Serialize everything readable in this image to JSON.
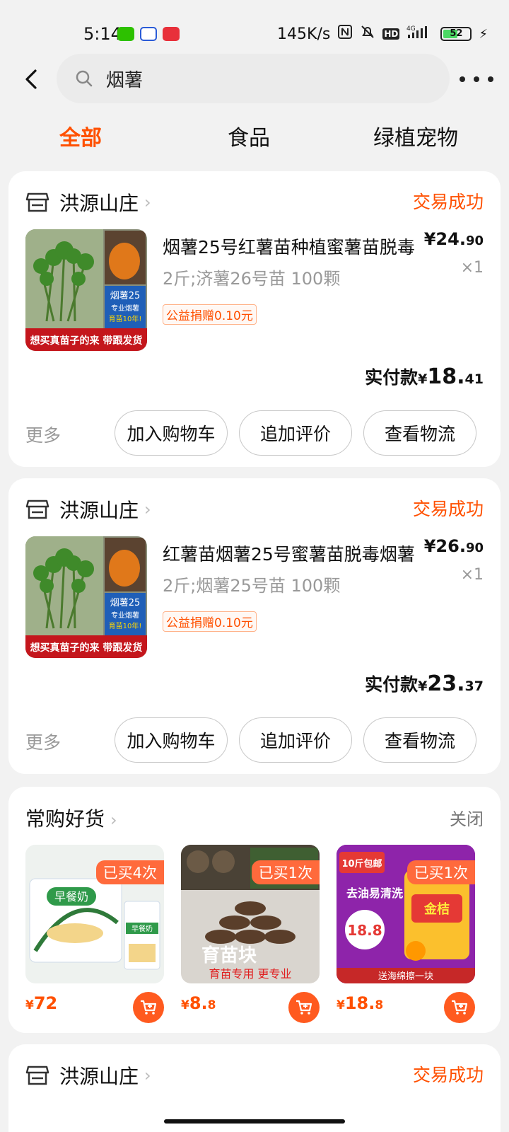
{
  "status_bar": {
    "time": "5:14",
    "network_speed": "145K/s",
    "network": "4G",
    "battery": "52"
  },
  "search": {
    "query": "烟薯"
  },
  "tabs": [
    {
      "label": "全部",
      "active": true
    },
    {
      "label": "食品",
      "active": false
    },
    {
      "label": "绿植宠物",
      "active": false
    }
  ],
  "orders": [
    {
      "shop": "洪源山庄",
      "status": "交易成功",
      "title": "烟薯25号红薯苗种植蜜薯苗脱毒",
      "spec": "2斤;济薯26号苗  100颗",
      "tag": "公益捐赠0.10元",
      "price_int": "¥24.",
      "price_dec": "90",
      "qty": "×1",
      "paid_label": "实付款",
      "paid_currency": "¥",
      "paid_int": "18.",
      "paid_dec": "41",
      "more": "更多",
      "btn_cart": "加入购物车",
      "btn_review": "追加评价",
      "btn_logistics": "查看物流"
    },
    {
      "shop": "洪源山庄",
      "status": "交易成功",
      "title": "红薯苗烟薯25号蜜薯苗脱毒烟薯",
      "spec": "2斤;烟薯25号苗  100颗",
      "tag": "公益捐赠0.10元",
      "price_int": "¥26.",
      "price_dec": "90",
      "qty": "×1",
      "paid_label": "实付款",
      "paid_currency": "¥",
      "paid_int": "23.",
      "paid_dec": "37",
      "more": "更多",
      "btn_cart": "加入购物车",
      "btn_review": "追加评价",
      "btn_logistics": "查看物流"
    }
  ],
  "thumb_text": {
    "banner": "想买真苗子的来 带跟发货",
    "label1": "烟薯25",
    "label2": "专业烟薯",
    "label3": "育苗10年!"
  },
  "frequent": {
    "title": "常购好货",
    "close": "关闭",
    "items": [
      {
        "badge": "已买4次",
        "price_cur": "¥",
        "price_int": "72",
        "price_dec": "",
        "img_text": "早餐奶"
      },
      {
        "badge": "已买1次",
        "price_cur": "¥",
        "price_int": "8.",
        "price_dec": "8",
        "img_text": "育苗块",
        "img_sub": "育苗专用 更专业"
      },
      {
        "badge": "已买1次",
        "price_cur": "¥",
        "price_int": "18.",
        "price_dec": "8",
        "img_text": "去油易清洗",
        "img_sub": "送海绵擦一块",
        "img_tag": "10斤包邮",
        "img_brand": "金桔",
        "img_price": "18.8"
      }
    ]
  },
  "partial_order": {
    "shop": "洪源山庄",
    "status": "交易成功"
  },
  "colors": {
    "accent": "#ff5000",
    "background": "#f2f2f2"
  }
}
